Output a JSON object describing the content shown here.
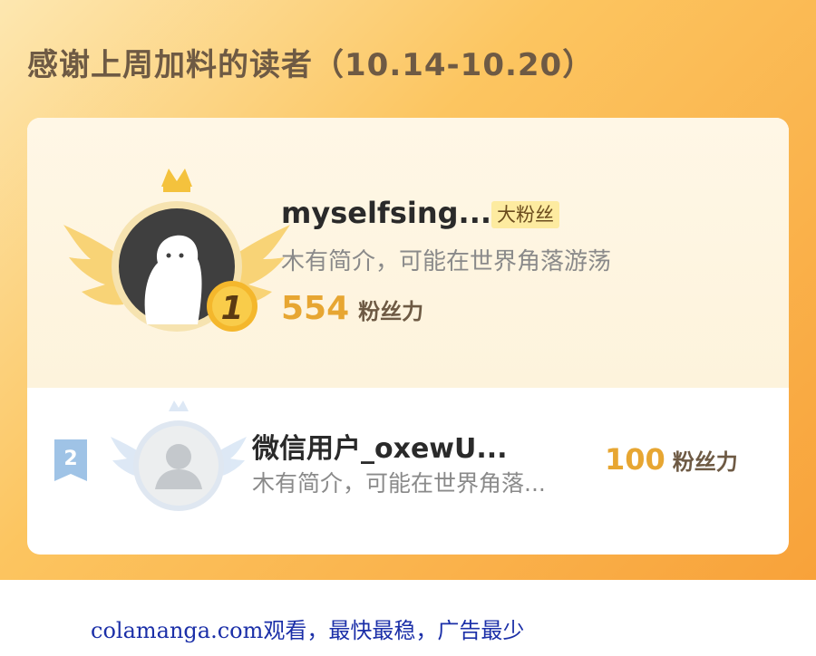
{
  "header": {
    "title": "感谢上周加料的读者（10.14-10.20）"
  },
  "ranking": [
    {
      "rank": "1",
      "name": "myselfsing...",
      "badge": "大粉丝",
      "bio": "木有简介，可能在世界角落游荡",
      "fan_power": "554",
      "fan_power_unit": "粉丝力"
    },
    {
      "rank": "2",
      "name": "微信用户_oxewU...",
      "bio": "木有简介，可能在世界角落...",
      "fan_power": "100",
      "fan_power_unit": "粉丝力"
    }
  ],
  "footer": {
    "text": "colamanga.com观看，最快最稳，广告最少"
  },
  "colors": {
    "accent": "#e7a632",
    "title_text": "#6e5a44",
    "badge_bg": "#fdeba0",
    "footer_text": "#1b2fa8"
  }
}
